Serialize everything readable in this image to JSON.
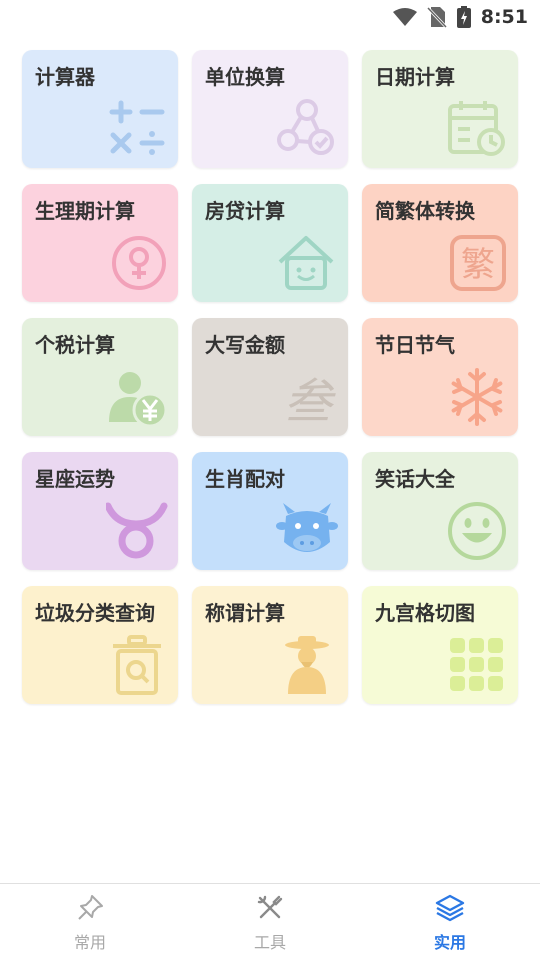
{
  "status_bar": {
    "time": "8:51"
  },
  "tiles": [
    {
      "label": "计算器",
      "icon": "math-operators-icon",
      "color": "#dbe9fb"
    },
    {
      "label": "单位换算",
      "icon": "conversion-nodes-icon",
      "color": "#f3ecf8"
    },
    {
      "label": "日期计算",
      "icon": "calendar-clock-icon",
      "color": "#e9f3e1"
    },
    {
      "label": "生理期计算",
      "icon": "female-symbol-icon",
      "color": "#fcd2de"
    },
    {
      "label": "房贷计算",
      "icon": "house-icon",
      "color": "#d5eee6"
    },
    {
      "label": "简繁体转换",
      "icon": "traditional-char-icon",
      "color": "#fdd3c4"
    },
    {
      "label": "个税计算",
      "icon": "person-yuan-icon",
      "color": "#e4f0dd"
    },
    {
      "label": "大写金额",
      "icon": "chinese-numeral-icon",
      "color": "#e0dbd6"
    },
    {
      "label": "节日节气",
      "icon": "snowflake-icon",
      "color": "#fdd7c9"
    },
    {
      "label": "星座运势",
      "icon": "taurus-icon",
      "color": "#ead8f1"
    },
    {
      "label": "生肖配对",
      "icon": "ox-face-icon",
      "color": "#c4dffb"
    },
    {
      "label": "笑话大全",
      "icon": "smiley-icon",
      "color": "#e7f2df"
    },
    {
      "label": "垃圾分类查询",
      "icon": "trash-bin-icon",
      "color": "#fdf1cd"
    },
    {
      "label": "称谓计算",
      "icon": "elder-person-icon",
      "color": "#fdf2d2"
    },
    {
      "label": "九宫格切图",
      "icon": "grid-nine-icon",
      "color": "#f6fbd6"
    }
  ],
  "tabs": [
    {
      "label": "常用",
      "icon": "pin-icon",
      "active": false
    },
    {
      "label": "工具",
      "icon": "tools-icon",
      "active": false
    },
    {
      "label": "实用",
      "icon": "layers-icon",
      "active": true
    }
  ],
  "colors": {
    "accent": "#2b78e4",
    "inactive": "#a8a8a8"
  }
}
